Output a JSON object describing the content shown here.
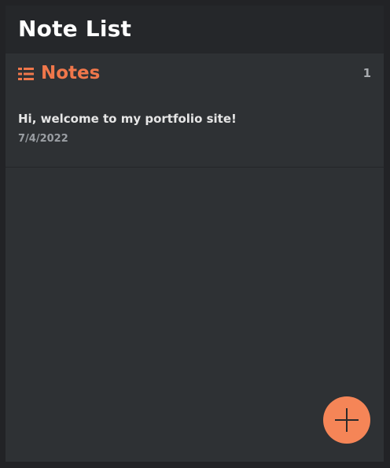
{
  "header": {
    "title": "Note List"
  },
  "section": {
    "icon": "list-icon",
    "title": "Notes",
    "count": "1"
  },
  "notes": [
    {
      "title": "Hi, welcome to my portfolio site!",
      "date": "7/4/2022"
    }
  ],
  "fab": {
    "icon": "plus-icon"
  },
  "colors": {
    "accent": "#f0774b",
    "fab": "#f58557",
    "panel": "#2e3134",
    "header": "#25272a",
    "background": "#222326"
  }
}
